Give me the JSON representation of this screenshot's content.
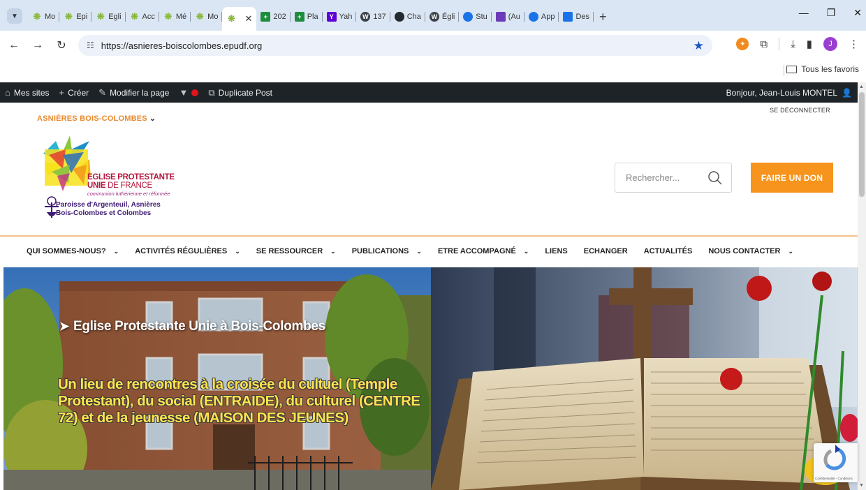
{
  "browser": {
    "tabs": [
      {
        "label": "Mo",
        "icon": "star-logo-icon",
        "icon_class": "star"
      },
      {
        "label": "Epi",
        "icon": "star-logo-icon",
        "icon_class": "star"
      },
      {
        "label": "Egli",
        "icon": "star-logo-icon",
        "icon_class": "star"
      },
      {
        "label": "Acc",
        "icon": "star-logo-icon",
        "icon_class": "star"
      },
      {
        "label": "Mé",
        "icon": "star-logo-icon",
        "icon_class": "star"
      },
      {
        "label": "Mo",
        "icon": "star-logo-icon",
        "icon_class": "star"
      },
      {
        "label": "",
        "icon": "star-logo-icon",
        "icon_class": "star",
        "active": true
      },
      {
        "label": "202",
        "icon": "sheets-icon",
        "icon_class": "sheets"
      },
      {
        "label": "Pla",
        "icon": "sheets-icon",
        "icon_class": "sheets"
      },
      {
        "label": "Yah",
        "icon": "yahoo-icon",
        "icon_class": "yahoo"
      },
      {
        "label": "137",
        "icon": "wordpress-icon",
        "icon_class": "wp"
      },
      {
        "label": "Cha",
        "icon": "github-icon",
        "icon_class": "gh"
      },
      {
        "label": "Égli",
        "icon": "wordpress-icon",
        "icon_class": "wp"
      },
      {
        "label": "Stu",
        "icon": "globe-icon",
        "icon_class": "blue"
      },
      {
        "label": "(Au",
        "icon": "mail-icon",
        "icon_class": "mail"
      },
      {
        "label": "App",
        "icon": "globe-icon",
        "icon_class": "blue"
      },
      {
        "label": "Des",
        "icon": "doc-icon",
        "icon_class": "doc"
      }
    ],
    "new_tab": "+",
    "url": "https://asnieres-boiscolombes.epudf.org",
    "profile_initial": "J",
    "all_favorites": "Tous les favoris"
  },
  "adminbar": {
    "my_sites": "Mes sites",
    "create": "Créer",
    "edit_page": "Modifier la page",
    "duplicate_post": "Duplicate Post",
    "greeting": "Bonjour, Jean-Louis MONTEL"
  },
  "header": {
    "logout": "SE DÉCONNECTER",
    "parish_select": "ASNIÈRES BOIS-COLOMBES",
    "logo": {
      "line1": "EGLISE PROTESTANTE",
      "line2_bold": "UNIE",
      "line2_thin": " DE FRANCE",
      "line3": "communion luthérienne et réformée",
      "line4": "Paroisse d'Argenteuil, Asnières",
      "line5": "Bois-Colombes et Colombes"
    },
    "search_placeholder": "Rechercher...",
    "donate": "FAIRE UN DON"
  },
  "nav": {
    "items": [
      {
        "label": "QUI SOMMES-NOUS?",
        "dropdown": true
      },
      {
        "label": "ACTIVITÉS RÉGULIÈRES",
        "dropdown": true
      },
      {
        "label": "SE RESSOURCER",
        "dropdown": true
      },
      {
        "label": "PUBLICATIONS",
        "dropdown": true
      },
      {
        "label": "ETRE ACCOMPAGNÉ",
        "dropdown": true
      },
      {
        "label": "LIENS",
        "dropdown": false
      },
      {
        "label": "ECHANGER",
        "dropdown": false
      },
      {
        "label": "ACTUALITÉS",
        "dropdown": false
      },
      {
        "label": "NOUS CONTACTER",
        "dropdown": true
      }
    ]
  },
  "hero": {
    "title": "Eglise Protestante Unie à Bois-Colombes",
    "subtitle": "Un lieu de rencontres à la croisée du cultuel (Temple Protestant), du social (ENTRAIDE), du culturel (CENTRE 72) et de la jeunesse (MAISON DES JEUNES)"
  },
  "recaptcha": {
    "label": "Confidentialité - Conditions"
  },
  "colors": {
    "accent_orange": "#f7941d",
    "adminbar_bg": "#1d2327",
    "hero_subtitle": "#ffe34d",
    "logo_red": "#b3173d"
  }
}
